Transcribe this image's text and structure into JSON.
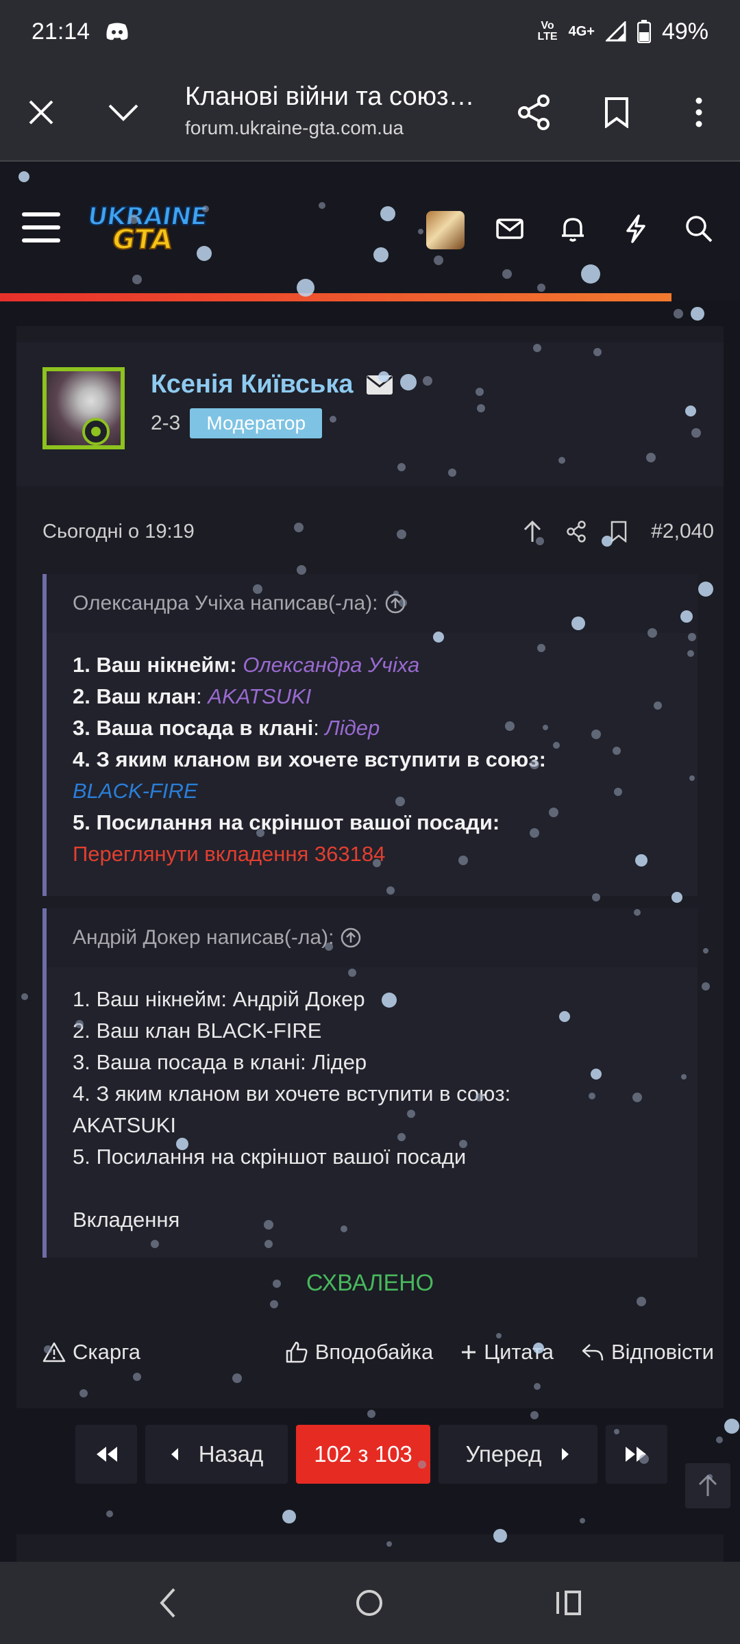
{
  "status_bar": {
    "time": "21:14",
    "network_top": "Vo",
    "network_mid": "LTE",
    "network_gen": "4G+",
    "battery": "49%"
  },
  "browser": {
    "title": "Кланові війни та союз…",
    "url": "forum.ukraine-gta.com.ua"
  },
  "site": {
    "logo_top": "UKRAINE",
    "logo_bottom": "GTA"
  },
  "post": {
    "username": "Ксенія Київська",
    "user_level": "2-3",
    "user_role": "Модератор",
    "date": "Сьогодні о 19:19",
    "post_number": "#2,040",
    "quote1": {
      "header": "Олександра Учіха написав(-ла):",
      "l1_label": "1. Ваш нікнейм:",
      "l1_value": "Олександра Учіха",
      "l2_label": "2. Ваш клан",
      "l2_sep": ":",
      "l2_value": "AKATSUKI",
      "l3_label": "3. Ваша посада в клані",
      "l3_sep": ":",
      "l3_value": "Лідер",
      "l4_label": "4. З яким кланом ви хочете вступити в союз:",
      "l4_value": "BLACK-FIRE",
      "l5_label": "5. Посилання на скріншот вашої посади:",
      "l5_link": "Переглянути вкладення 363184"
    },
    "quote2": {
      "header": "Андрій Докер написав(-ла):",
      "lines": [
        "1. Ваш нікнейм: Андрій Докер",
        "2. Ваш клан BLACK-FIRE",
        "3. Ваша посада в клані: Лідер",
        "4. З яким кланом ви хочете вступити в союз:",
        "AKATSUKI",
        "5. Посилання на скріншот вашої посади",
        "",
        "Вкладення"
      ]
    },
    "status": "СХВАЛЕНО",
    "actions": {
      "report": "Скарга",
      "like": "Вподобайка",
      "quote": "Цитата",
      "reply": "Відповісти"
    }
  },
  "pagination": {
    "prev": "Назад",
    "current": "102 з 103",
    "next": "Уперед"
  },
  "colors": {
    "accent_red": "#e62b23",
    "username_blue": "#8ecaf0",
    "moderator_badge": "#7ec3e3",
    "approved_green": "#48b85c",
    "quote_bar": "#6f6ca8"
  }
}
